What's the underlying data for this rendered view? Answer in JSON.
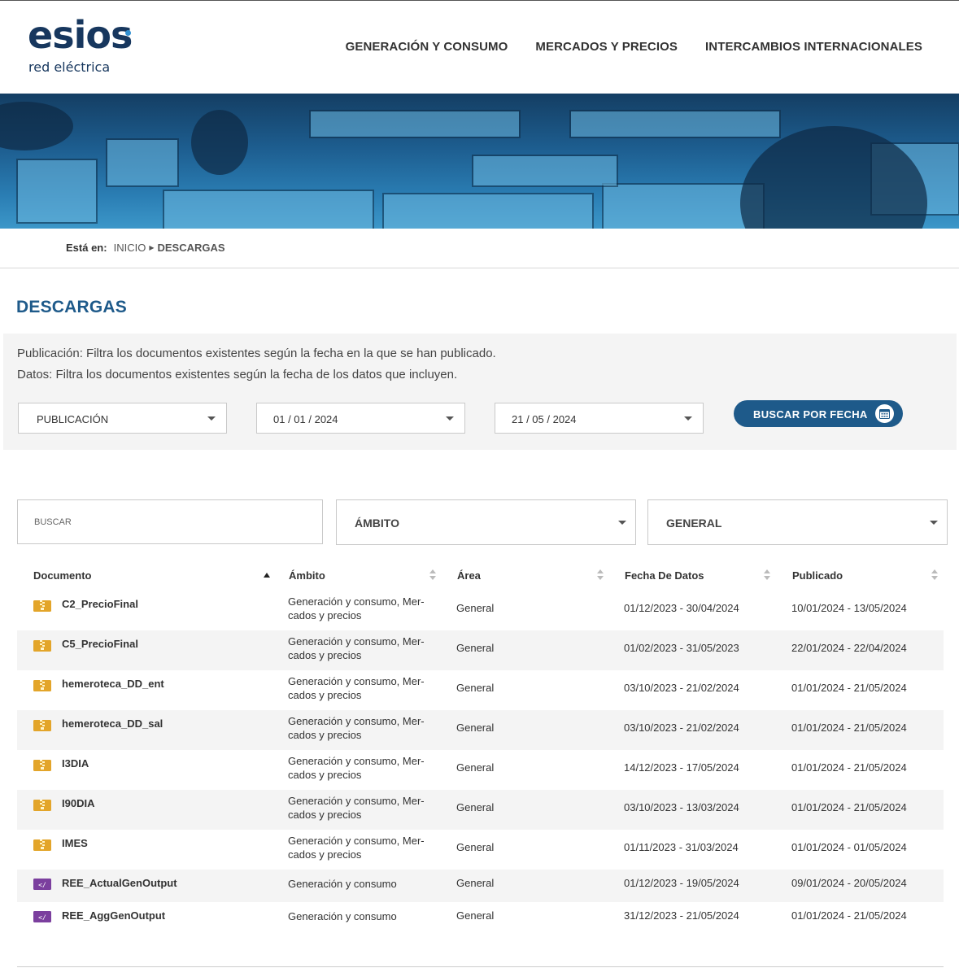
{
  "header": {
    "logo_main": "esios",
    "logo_sub": "red eléctrica",
    "nav": [
      "GENERACIÓN Y CONSUMO",
      "MERCADOS Y PRECIOS",
      "INTERCAMBIOS INTERNACIONALES"
    ]
  },
  "breadcrumb": {
    "label": "Está en:",
    "home": "INICIO",
    "current": "DESCARGAS"
  },
  "page_title": "DESCARGAS",
  "filters": {
    "line1": "Publicación: Filtra los documentos existentes según la fecha en la que se han publicado.",
    "line2": "Datos: Filtra los documentos existentes según la fecha de los datos que incluyen.",
    "type_select": "PUBLICACIÓN",
    "date_from": "01 / 01 / 2024",
    "date_to": "21 / 05 / 2024",
    "search_button": "BUSCAR POR FECHA"
  },
  "search": {
    "placeholder": "BUSCAR",
    "ambito_select": "ÁMBITO",
    "area_select": "GENERAL"
  },
  "table": {
    "headers": {
      "documento": "Documento",
      "ambito": "Ámbito",
      "area": "Área",
      "fecha": "Fecha De Datos",
      "publicado": "Publicado"
    },
    "rows": [
      {
        "icon": "zip-file-icon",
        "name": "C2_PrecioFinal",
        "ambito": "Generación y consumo, Mer-cados y precios",
        "area": "General",
        "fecha": "01/12/2023 - 30/04/2024",
        "publicado": "10/01/2024 - 13/05/2024"
      },
      {
        "icon": "zip-file-icon",
        "name": "C5_PrecioFinal",
        "ambito": "Generación y consumo, Mer-cados y precios",
        "area": "General",
        "fecha": "01/02/2023 - 31/05/2023",
        "publicado": "22/01/2024 - 22/04/2024"
      },
      {
        "icon": "zip-file-icon",
        "name": "hemeroteca_DD_ent",
        "ambito": "Generación y consumo, Mer-cados y precios",
        "area": "General",
        "fecha": "03/10/2023 - 21/02/2024",
        "publicado": "01/01/2024 - 21/05/2024"
      },
      {
        "icon": "zip-file-icon",
        "name": "hemeroteca_DD_sal",
        "ambito": "Generación y consumo, Mer-cados y precios",
        "area": "General",
        "fecha": "03/10/2023 - 21/02/2024",
        "publicado": "01/01/2024 - 21/05/2024"
      },
      {
        "icon": "zip-file-icon",
        "name": "I3DIA",
        "ambito": "Generación y consumo, Mer-cados y precios",
        "area": "General",
        "fecha": "14/12/2023 - 17/05/2024",
        "publicado": "01/01/2024 - 21/05/2024"
      },
      {
        "icon": "zip-file-icon",
        "name": "I90DIA",
        "ambito": "Generación y consumo, Mer-cados y precios",
        "area": "General",
        "fecha": "03/10/2023 - 13/03/2024",
        "publicado": "01/01/2024 - 21/05/2024"
      },
      {
        "icon": "zip-file-icon",
        "name": "IMES",
        "ambito": "Generación y consumo, Mer-cados y precios",
        "area": "General",
        "fecha": "01/11/2023 - 31/03/2024",
        "publicado": "01/01/2024 - 01/05/2024"
      },
      {
        "icon": "xml-file-icon",
        "name": "REE_ActualGenOutput",
        "ambito": "Generación y consumo",
        "area": "General",
        "fecha": "01/12/2023 - 19/05/2024",
        "publicado": "09/01/2024 - 20/05/2024"
      },
      {
        "icon": "xml-file-icon",
        "name": "REE_AggGenOutput",
        "ambito": "Generación y consumo",
        "area": "General",
        "fecha": "31/12/2023 - 21/05/2024",
        "publicado": "01/01/2024 - 21/05/2024"
      }
    ]
  },
  "colors": {
    "brand": "#17375e",
    "accent": "#1e5a8a",
    "zip": "#e3a52a",
    "xml": "#7b3f9e"
  }
}
